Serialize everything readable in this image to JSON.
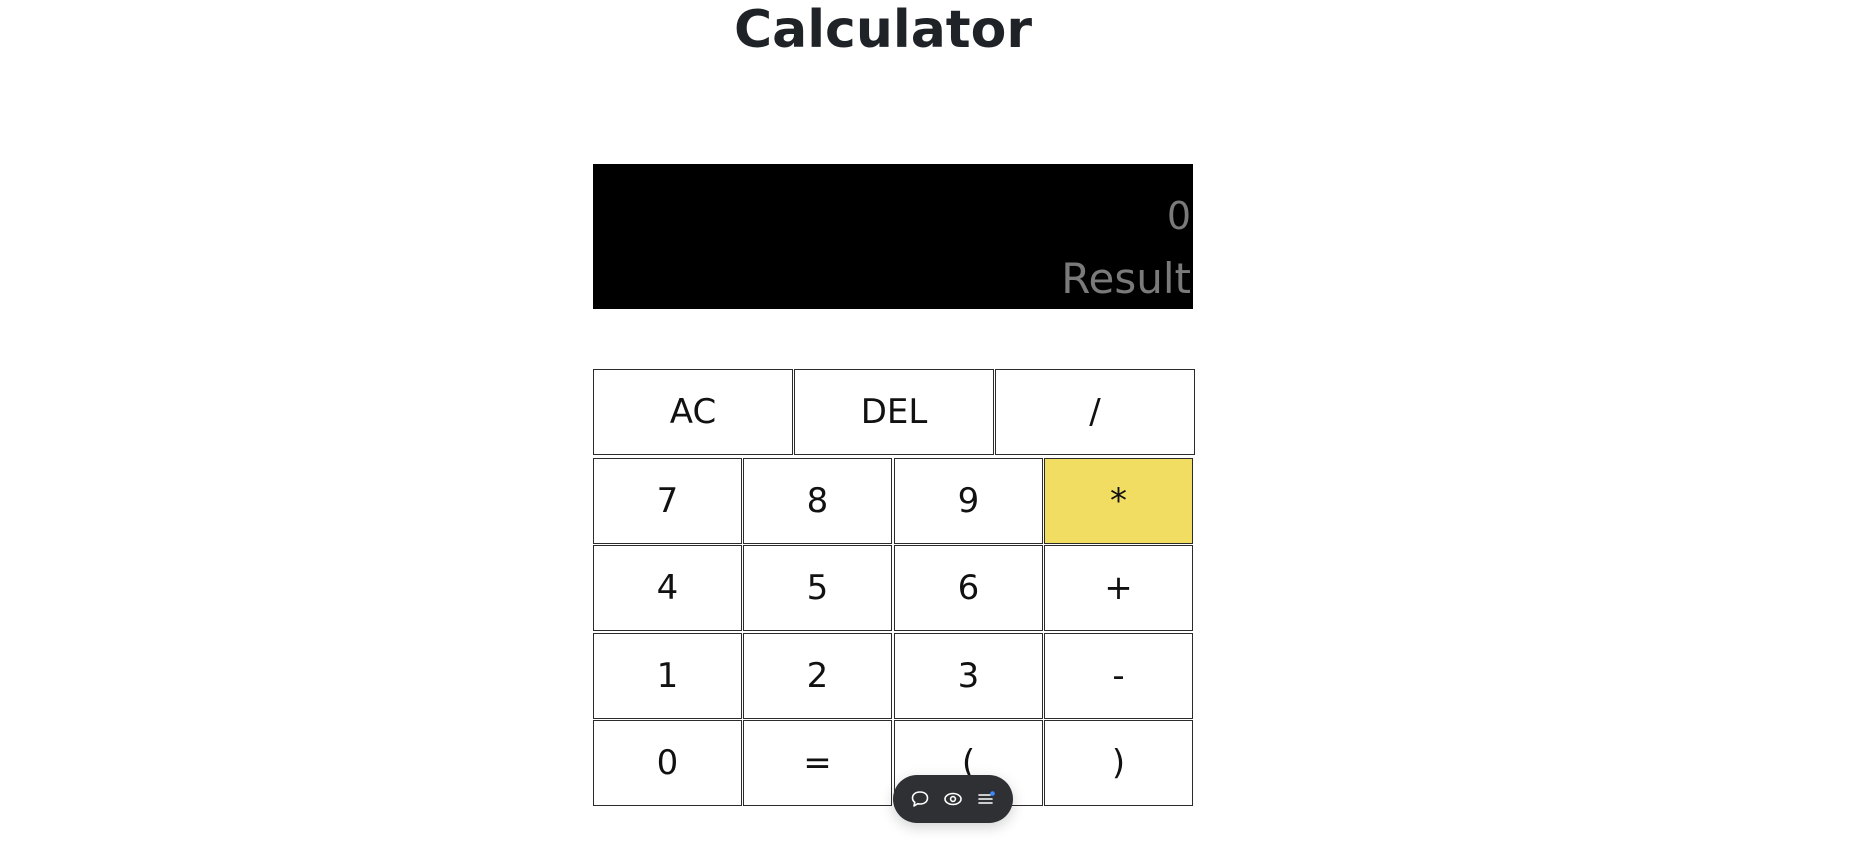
{
  "page": {
    "title": "Calculator"
  },
  "display": {
    "expression": "0",
    "result": "Result",
    "background": "#000000",
    "text_color": "#7a7a7a"
  },
  "keys": {
    "row0": [
      "AC",
      "DEL",
      "/"
    ],
    "row1": [
      "7",
      "8",
      "9",
      "*"
    ],
    "row2": [
      "4",
      "5",
      "6",
      "+"
    ],
    "row3": [
      "1",
      "2",
      "3",
      "-"
    ],
    "row4": [
      "0",
      "=",
      "(",
      ")"
    ]
  },
  "colors": {
    "accent": "#f2dd63",
    "toolbar": "#2f3033",
    "notification_dot": "#3b8bff"
  },
  "toolbar": {
    "icons": [
      "comment-icon",
      "eye-icon",
      "list-icon"
    ]
  }
}
